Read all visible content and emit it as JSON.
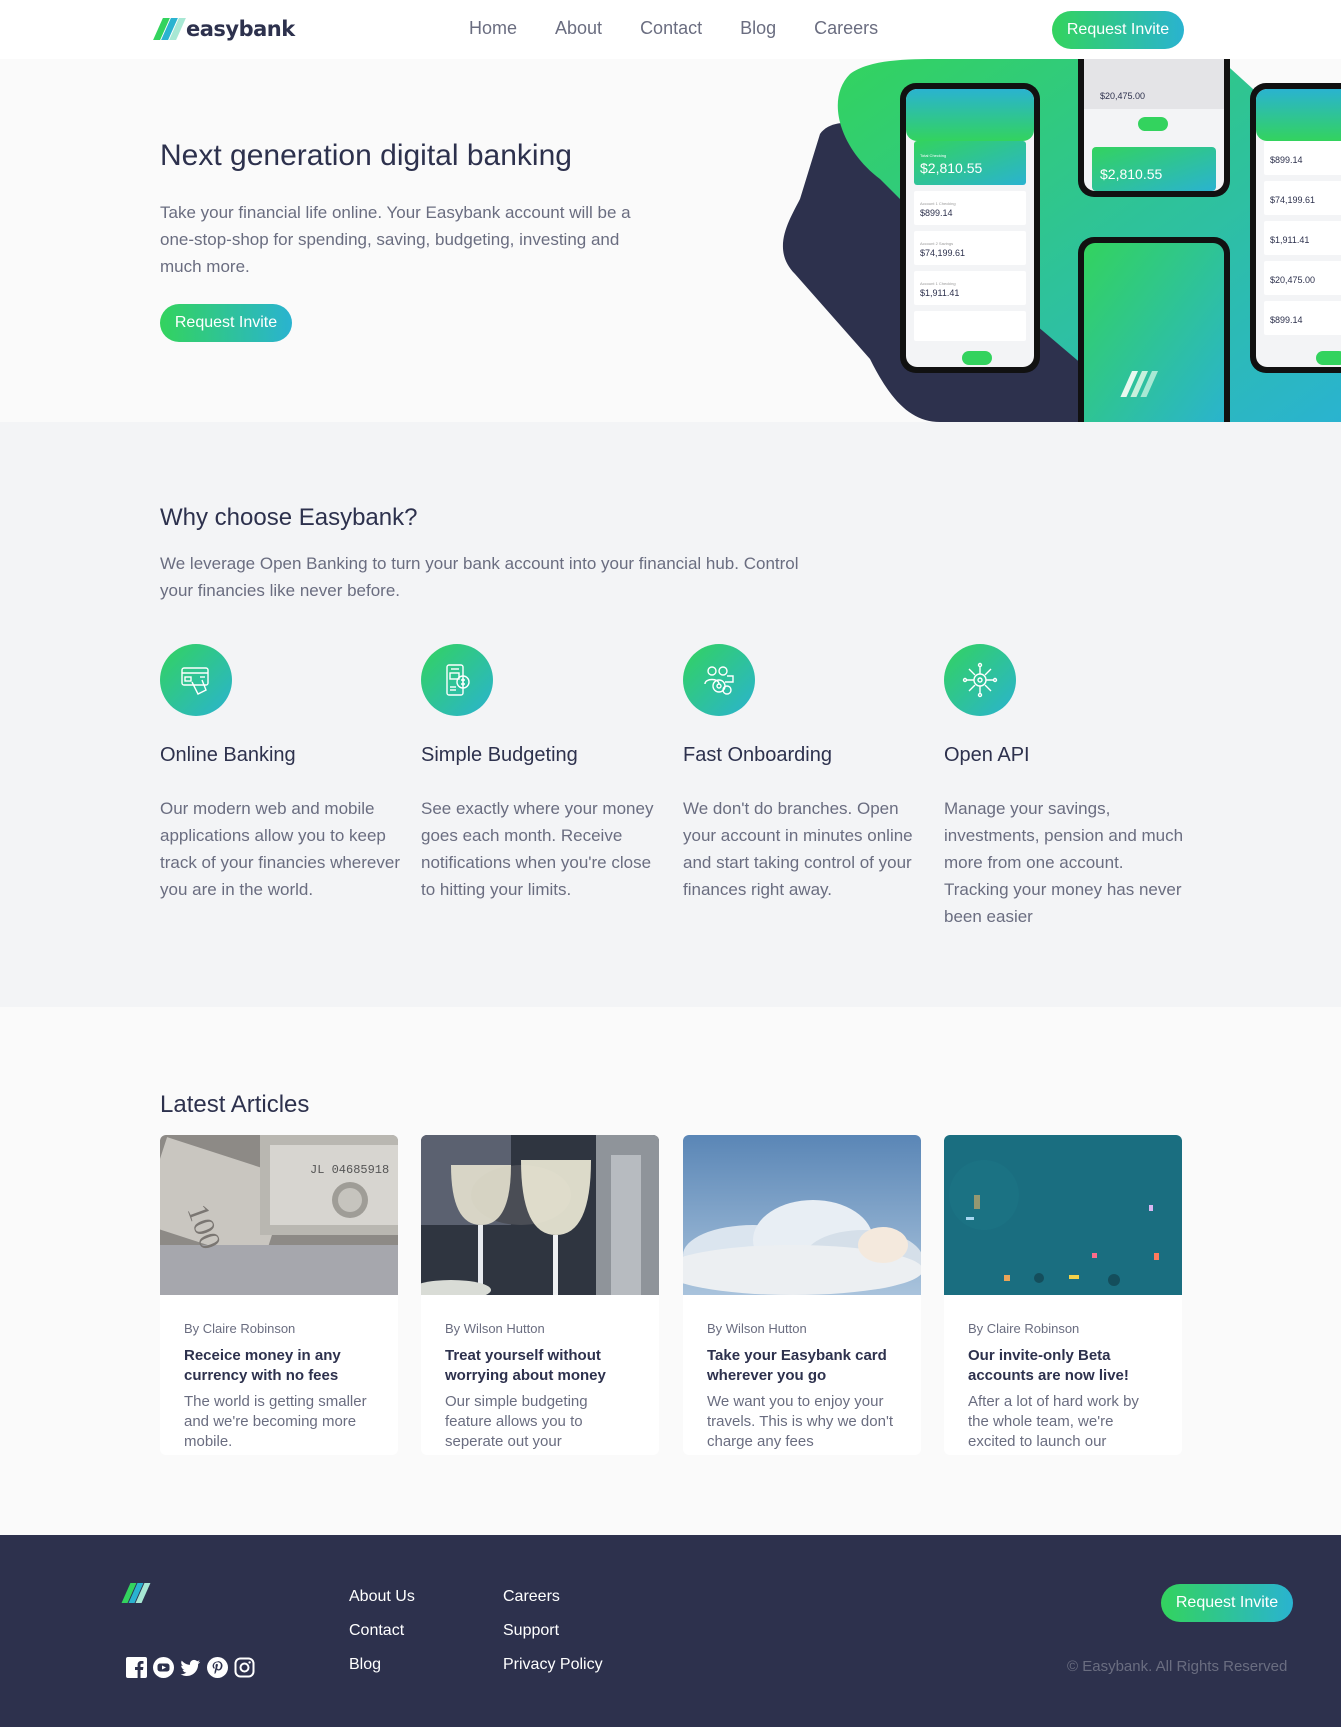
{
  "brand": {
    "name": "easybank"
  },
  "nav": {
    "links": [
      "Home",
      "About",
      "Contact",
      "Blog",
      "Careers"
    ],
    "cta": "Request Invite"
  },
  "hero": {
    "title": "Next generation digital banking",
    "text": "Take your financial life online. Your Easybank account will be a one-stop-shop for spending, saving, budgeting, investing and much more.",
    "cta": "Request Invite",
    "phone_values": {
      "total_checking_label": "Total Checking",
      "total_checking": "$2,810.55",
      "accounts": [
        {
          "label": "Account 1 Checking",
          "value": "$899.14"
        },
        {
          "label": "Account 2 Savings",
          "value": "$74,199.61"
        },
        {
          "label": "Account 1 Checking",
          "value": "$1,911.41"
        },
        {
          "label": "Account 2 Savings",
          "value": "$20,475.00"
        }
      ]
    }
  },
  "why": {
    "title": "Why choose Easybank?",
    "subtitle": "We leverage Open Banking to turn your bank account into your financial hub. Control your financies like never before.",
    "features": [
      {
        "title": "Online Banking",
        "text": "Our modern web and mobile applications allow you to keep track of your financies wherever you are in the world.",
        "icon": "online-banking-icon"
      },
      {
        "title": "Simple Budgeting",
        "text": "See exactly where your money goes each month. Receive notifications when you're close to hitting your limits.",
        "icon": "budgeting-icon"
      },
      {
        "title": "Fast Onboarding",
        "text": "We don't do branches. Open your account in minutes online and start taking control of your finances right away.",
        "icon": "onboarding-icon"
      },
      {
        "title": "Open API",
        "text": "Manage your savings, investments, pension and much more from one account. Tracking your money has never been easier",
        "icon": "api-icon"
      }
    ]
  },
  "articles": {
    "title": "Latest Articles",
    "items": [
      {
        "author": "By Claire Robinson",
        "title": "Receice money in any currency with no fees",
        "text": "The world is getting smaller and we're becoming more mobile."
      },
      {
        "author": "By Wilson Hutton",
        "title": "Treat yourself without worrying about money",
        "text": "Our simple budgeting feature allows you to seperate out your"
      },
      {
        "author": "By Wilson Hutton",
        "title": "Take your Easybank card wherever you go",
        "text": "We want you to enjoy your travels. This is why we don't charge any fees"
      },
      {
        "author": "By Claire Robinson",
        "title": "Our invite-only Beta accounts are now live!",
        "text": "After a lot of hard work by the whole team, we're excited to launch our"
      }
    ]
  },
  "footer": {
    "col1": [
      "About Us",
      "Contact",
      "Blog"
    ],
    "col2": [
      "Careers",
      "Support",
      "Privacy Policy"
    ],
    "cta": "Request Invite",
    "copyright": "© Easybank. All Rights Reserved",
    "socials": [
      "facebook-icon",
      "youtube-icon",
      "twitter-icon",
      "pinterest-icon",
      "instagram-icon"
    ]
  },
  "colors": {
    "primary_dark": "#2d314d",
    "green": "#33d35e",
    "cyan": "#2ab3d0",
    "grey_text": "#6a6d80"
  }
}
